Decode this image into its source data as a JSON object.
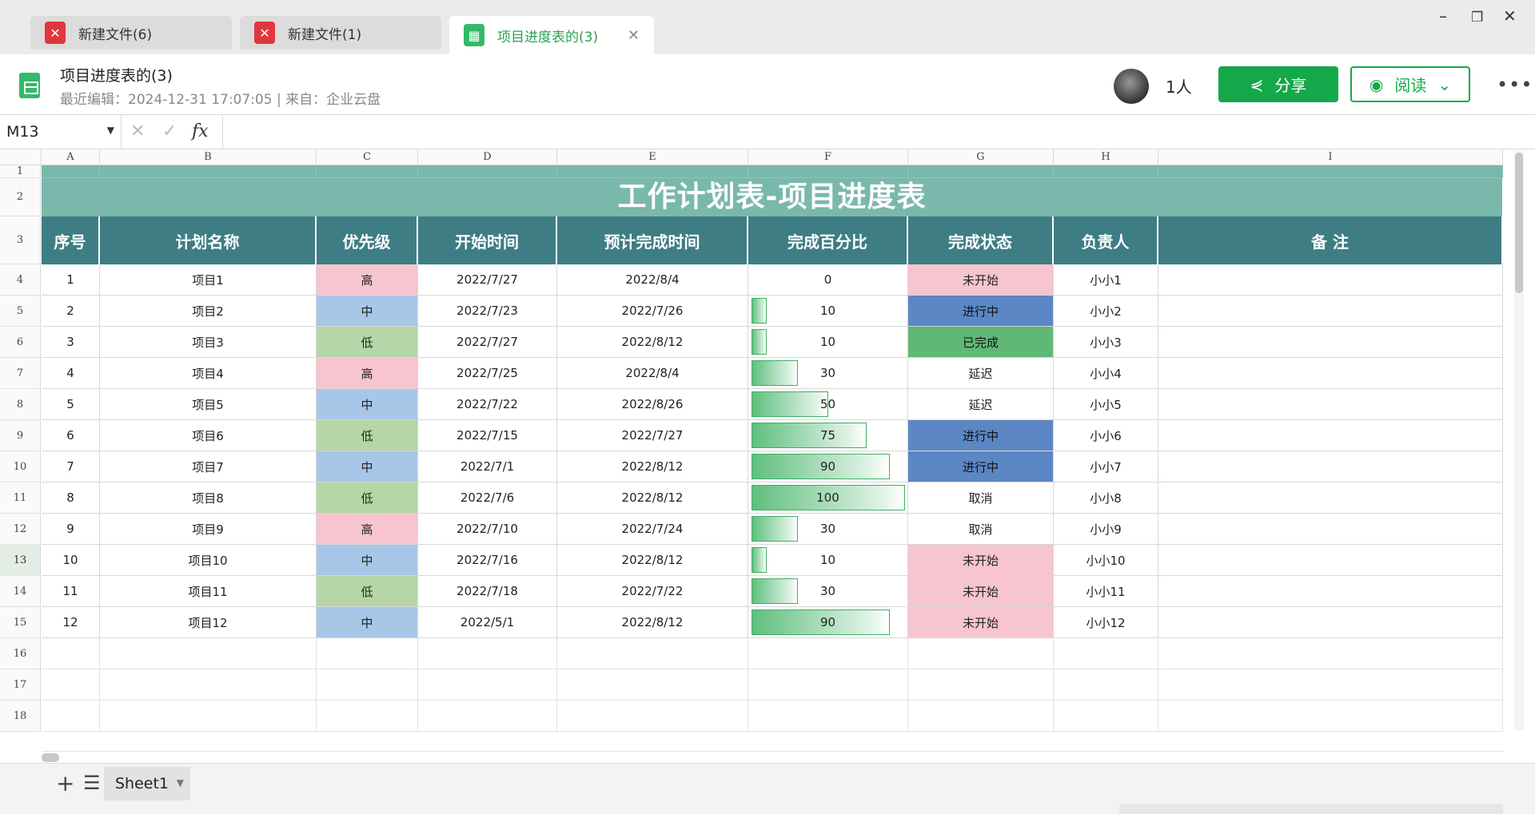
{
  "tabs": [
    {
      "label": "新建文件(6)",
      "icon": "pdf-file-icon"
    },
    {
      "label": "新建文件(1)",
      "icon": "pdf-file-icon"
    },
    {
      "label": "项目进度表的(3)",
      "icon": "spreadsheet-file-icon"
    }
  ],
  "doc": {
    "title": "项目进度表的(3)",
    "meta": "最近编辑：2024-12-31 17:07:05 | 来自：企业云盘",
    "people": "1人",
    "share_label": "分享",
    "read_label": "阅读"
  },
  "formula": {
    "cell_ref": "M13",
    "fx": "fx"
  },
  "columns": [
    "A",
    "B",
    "C",
    "D",
    "E",
    "F",
    "G",
    "H",
    "I"
  ],
  "sheet": {
    "title": "工作计划表-项目进度表",
    "headers": [
      "序号",
      "计划名称",
      "优先级",
      "开始时间",
      "预计完成时间",
      "完成百分比",
      "完成状态",
      "负责人",
      "备  注"
    ],
    "rows": [
      {
        "no": "1",
        "name": "项目1",
        "priority": "高",
        "start": "2022/7/27",
        "end": "2022/8/4",
        "pct": 0,
        "status": "未开始",
        "owner": "小小1"
      },
      {
        "no": "2",
        "name": "项目2",
        "priority": "中",
        "start": "2022/7/23",
        "end": "2022/7/26",
        "pct": 10,
        "status": "进行中",
        "owner": "小小2"
      },
      {
        "no": "3",
        "name": "项目3",
        "priority": "低",
        "start": "2022/7/27",
        "end": "2022/8/12",
        "pct": 10,
        "status": "已完成",
        "owner": "小小3"
      },
      {
        "no": "4",
        "name": "项目4",
        "priority": "高",
        "start": "2022/7/25",
        "end": "2022/8/4",
        "pct": 30,
        "status": "延迟",
        "owner": "小小4"
      },
      {
        "no": "5",
        "name": "项目5",
        "priority": "中",
        "start": "2022/7/22",
        "end": "2022/8/26",
        "pct": 50,
        "status": "延迟",
        "owner": "小小5"
      },
      {
        "no": "6",
        "name": "项目6",
        "priority": "低",
        "start": "2022/7/15",
        "end": "2022/7/27",
        "pct": 75,
        "status": "进行中",
        "owner": "小小6"
      },
      {
        "no": "7",
        "name": "项目7",
        "priority": "中",
        "start": "2022/7/1",
        "end": "2022/8/12",
        "pct": 90,
        "status": "进行中",
        "owner": "小小7"
      },
      {
        "no": "8",
        "name": "项目8",
        "priority": "低",
        "start": "2022/7/6",
        "end": "2022/8/12",
        "pct": 100,
        "status": "取消",
        "owner": "小小8"
      },
      {
        "no": "9",
        "name": "项目9",
        "priority": "高",
        "start": "2022/7/10",
        "end": "2022/7/24",
        "pct": 30,
        "status": "取消",
        "owner": "小小9"
      },
      {
        "no": "10",
        "name": "项目10",
        "priority": "中",
        "start": "2022/7/16",
        "end": "2022/8/12",
        "pct": 10,
        "status": "未开始",
        "owner": "小小10"
      },
      {
        "no": "11",
        "name": "项目11",
        "priority": "低",
        "start": "2022/7/18",
        "end": "2022/7/22",
        "pct": 30,
        "status": "未开始",
        "owner": "小小11"
      },
      {
        "no": "12",
        "name": "项目12",
        "priority": "中",
        "start": "2022/5/1",
        "end": "2022/8/12",
        "pct": 90,
        "status": "未开始",
        "owner": "小小12"
      }
    ]
  },
  "colors": {
    "title_bg": "#7ab8ac",
    "header_bg": "#3e7d84",
    "high": "#f7c5cf",
    "mid": "#a7c6e8",
    "low": "#b5d6a6",
    "in_progress": "#5b87c5",
    "done": "#5fb876",
    "not_started": "#f7c5cf",
    "accent": "#14a84a"
  },
  "sheet_tab": "Sheet1"
}
